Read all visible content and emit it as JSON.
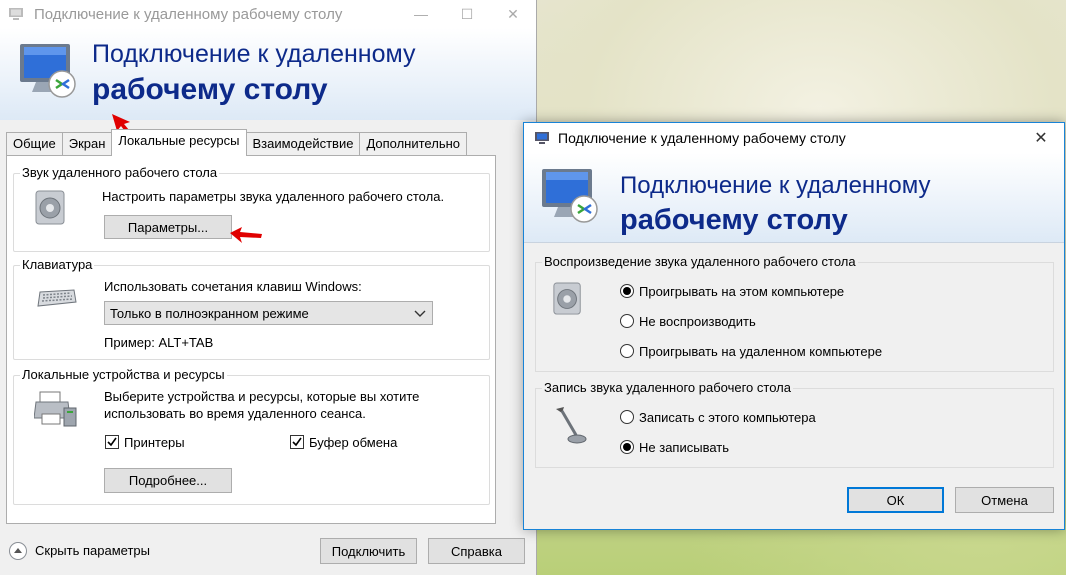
{
  "main": {
    "title": "Подключение к удаленному рабочему столу",
    "banner_line1": "Подключение к удаленному",
    "banner_line2": "рабочему столу",
    "tabs": [
      {
        "label": "Общие"
      },
      {
        "label": "Экран"
      },
      {
        "label": "Локальные ресурсы",
        "active": true
      },
      {
        "label": "Взаимодействие"
      },
      {
        "label": "Дополнительно"
      }
    ],
    "audio_group": {
      "legend": "Звук удаленного рабочего стола",
      "description": "Настроить параметры звука удаленного рабочего стола.",
      "button": "Параметры..."
    },
    "keyboard_group": {
      "legend": "Клавиатура",
      "description": "Использовать сочетания клавиш Windows:",
      "selected": "Только в полноэкранном режиме",
      "example": "Пример: ALT+TAB"
    },
    "devices_group": {
      "legend": "Локальные устройства и ресурсы",
      "description_line1": "Выберите устройства и ресурсы, которые вы хотите",
      "description_line2": "использовать во время удаленного сеанса.",
      "printers": {
        "label": "Принтеры",
        "checked": true
      },
      "clipboard": {
        "label": "Буфер обмена",
        "checked": true
      },
      "more_button": "Подробнее..."
    },
    "footer": {
      "hide_options": "Скрыть параметры",
      "connect": "Подключить",
      "help": "Справка"
    }
  },
  "dialog": {
    "title": "Подключение к удаленному рабочему столу",
    "banner_line1": "Подключение к удаленному",
    "banner_line2": "рабочему столу",
    "playback_group": {
      "legend": "Воспроизведение звука удаленного рабочего стола",
      "options": [
        {
          "label": "Проигрывать на этом компьютере",
          "selected": true
        },
        {
          "label": "Не воспроизводить",
          "selected": false
        },
        {
          "label": "Проигрывать на удаленном компьютере",
          "selected": false
        }
      ]
    },
    "recording_group": {
      "legend": "Запись звука удаленного рабочего стола",
      "options": [
        {
          "label": "Записать с этого компьютера",
          "selected": false
        },
        {
          "label": "Не записывать",
          "selected": true
        }
      ]
    },
    "ok": "ОК",
    "cancel": "Отмена"
  },
  "colors": {
    "banner_text": "#0d2a8a",
    "accent": "#0078d7",
    "annotation_arrow": "#e00000"
  }
}
